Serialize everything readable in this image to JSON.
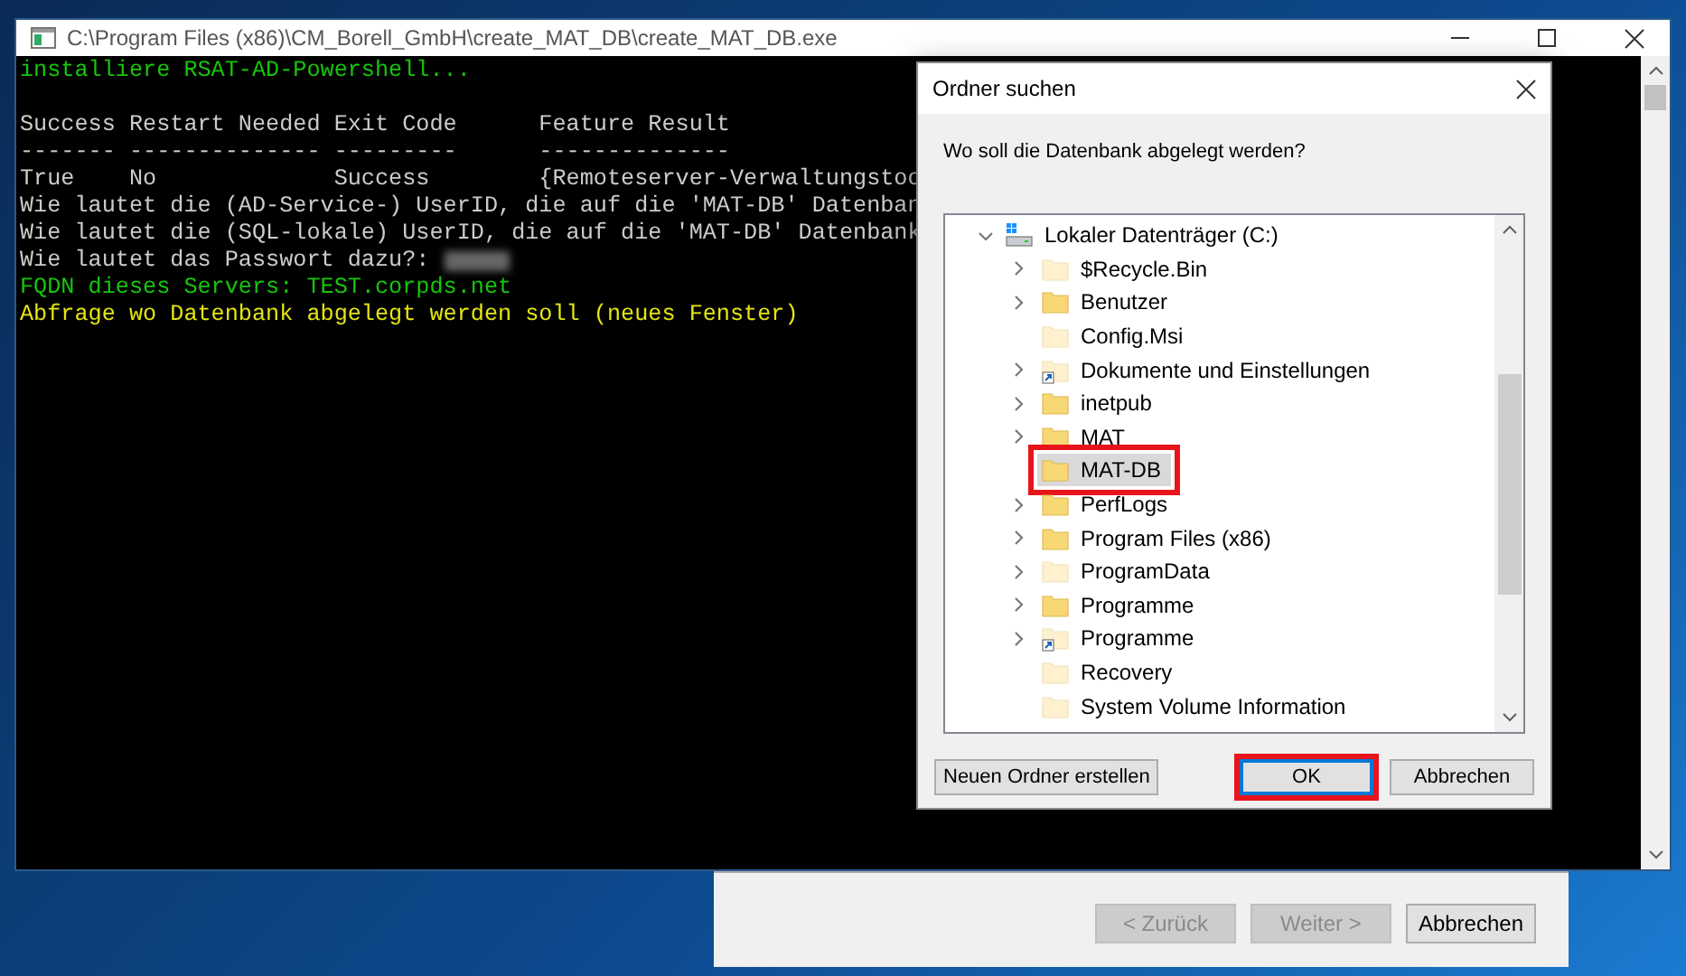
{
  "console_window": {
    "title": "C:\\Program Files (x86)\\CM_Borell_GmbH\\create_MAT_DB\\create_MAT_DB.exe",
    "lines": [
      {
        "kind": "success",
        "text": "installiere RSAT-AD-Powershell..."
      },
      {
        "kind": "blank"
      },
      {
        "kind": "plain",
        "text": "Success Restart Needed Exit Code      Feature Result"
      },
      {
        "kind": "plain",
        "text": "------- -------------- ---------      --------------"
      },
      {
        "kind": "plain",
        "text": "True    No             Success        {Remoteserver-Verwaltungstoo"
      },
      {
        "kind": "plain",
        "text": "Wie lautet die (AD-Service-) UserID, die auf die 'MAT-DB' Datenban"
      },
      {
        "kind": "plain",
        "text": "Wie lautet die (SQL-lokale) UserID, die auf die 'MAT-DB' Datenbank"
      },
      {
        "kind": "plain",
        "text": "Wie lautet das Passwort dazu?:",
        "redacted": true
      },
      {
        "kind": "success",
        "text": "FQDN dieses Servers: TEST.corpds.net"
      },
      {
        "kind": "notice",
        "text": "Abfrage wo Datenbank abgelegt werden soll (neues Fenster)"
      }
    ]
  },
  "dialog": {
    "title": "Ordner suchen",
    "prompt": "Wo soll die Datenbank abgelegt werden?",
    "tree": {
      "label": "Lokaler Datenträger (C:)",
      "expanded": true,
      "children": [
        {
          "label": "$Recycle.Bin",
          "expandable": true,
          "hidden": true,
          "shortcut": false,
          "selected": false
        },
        {
          "label": "Benutzer",
          "expandable": true,
          "hidden": false,
          "shortcut": false,
          "selected": false
        },
        {
          "label": "Config.Msi",
          "expandable": false,
          "hidden": true,
          "shortcut": false,
          "selected": false
        },
        {
          "label": "Dokumente und Einstellungen",
          "expandable": true,
          "hidden": true,
          "shortcut": true,
          "selected": false
        },
        {
          "label": "inetpub",
          "expandable": true,
          "hidden": false,
          "shortcut": false,
          "selected": false
        },
        {
          "label": "MAT",
          "expandable": true,
          "hidden": false,
          "shortcut": false,
          "selected": false
        },
        {
          "label": "MAT-DB",
          "expandable": false,
          "hidden": false,
          "shortcut": false,
          "selected": true,
          "highlighted": true
        },
        {
          "label": "PerfLogs",
          "expandable": true,
          "hidden": false,
          "shortcut": false,
          "selected": false
        },
        {
          "label": "Program Files (x86)",
          "expandable": true,
          "hidden": false,
          "shortcut": false,
          "selected": false
        },
        {
          "label": "ProgramData",
          "expandable": true,
          "hidden": true,
          "shortcut": false,
          "selected": false
        },
        {
          "label": "Programme",
          "expandable": true,
          "hidden": false,
          "shortcut": false,
          "selected": false
        },
        {
          "label": "Programme",
          "expandable": true,
          "hidden": true,
          "shortcut": true,
          "selected": false
        },
        {
          "label": "Recovery",
          "expandable": false,
          "hidden": true,
          "shortcut": false,
          "selected": false
        },
        {
          "label": "System Volume Information",
          "expandable": false,
          "hidden": true,
          "shortcut": false,
          "selected": false
        }
      ]
    },
    "buttons": [
      {
        "label": "Neuen Ordner erstellen",
        "default": false,
        "highlighted": false
      },
      {
        "label": "OK",
        "default": true,
        "highlighted": true
      },
      {
        "label": "Abbrechen",
        "default": false,
        "highlighted": false
      }
    ]
  },
  "wizard": {
    "buttons": [
      {
        "label": "< Zurück",
        "disabled": true
      },
      {
        "label": "Weiter >",
        "disabled": true
      },
      {
        "label": "Abbrechen",
        "disabled": false
      }
    ]
  }
}
